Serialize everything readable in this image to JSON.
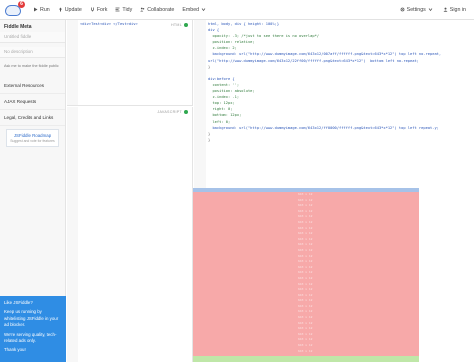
{
  "toolbar": {
    "logo_badge": "6",
    "run": "Run",
    "update": "Update",
    "fork": "Fork",
    "tidy": "Tidy",
    "collaborate": "Collaborate",
    "embed": "Embed",
    "settings": "Settings",
    "signin": "Sign in"
  },
  "sidebar": {
    "fiddle_meta": "Fiddle Meta",
    "title_placeholder": "Untitled fiddle",
    "desc_placeholder": "No description",
    "private_note": "Ask me to make the fiddle public",
    "links": [
      "External Resources",
      "AJAX Requests",
      "Legal, Credits and Links"
    ],
    "roadmap_title": "JSFiddle Roadmap",
    "roadmap_sub": "Suggest and vote for features",
    "promo_title": "Like JSFiddle?",
    "promo_line1": "Keep us running by whitelisting JSFiddle in your ad blocker.",
    "promo_line2": "We're serving quality, tech-related ads only.",
    "promo_line3": "Thank you!"
  },
  "panes": {
    "html_label": "HTML",
    "js_label": "JAVASCRIPT",
    "html_code": "<div>Test<div> </Test>div>",
    "css_code": [
      "html, body, div { height: 100%;}",
      "div {",
      "  opacity: .3; /*just to see there is no overlap*/",
      "  position: relative;",
      "  z-index: 2;",
      "  background: url(\"http://www.dummyimage.com/643x12/007aff/ffffff.png&text=643*x*12\") top left no-repeat,",
      "url(\"http://www.dummyimage.com/643x12/22ff00/ffffff.png&text=643*x*12\")  bottom left no-repeat;",
      "}",
      "",
      "div:before {",
      "  content: '';",
      "  position: absolute;",
      "  z-index: -1;",
      "  top: 12px;",
      "  right: 0;",
      "  bottom: 12px;",
      "  left: 0;",
      "  background: url(\"http://www.dummyimage.com/643x12/ff0000/ffffff.png&text=643*x*12\") top left repeat-y;",
      "}",
      "}"
    ]
  },
  "result": {
    "tile_text": "643 x 12"
  },
  "colors": {
    "promo_blue": "#2f8de4",
    "result_red": "#f7a9a9",
    "result_blue": "#a6c2e8",
    "result_green": "#bfe7a8"
  }
}
